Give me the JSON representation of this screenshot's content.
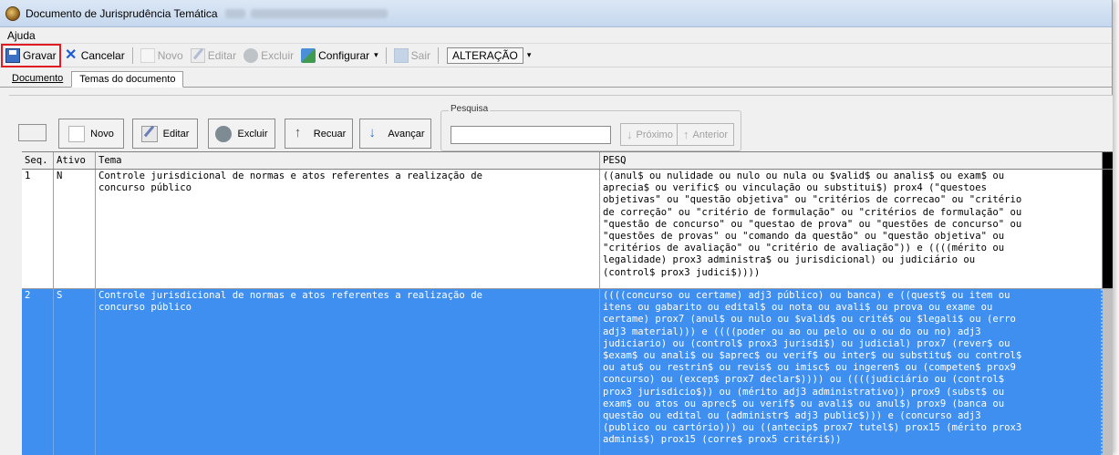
{
  "window": {
    "title": "Documento de Jurisprudência Temática"
  },
  "menu": [
    "Ajuda"
  ],
  "toolbar": {
    "save_label": "Gravar",
    "cancel_label": "Cancelar",
    "new_label": "Novo",
    "edit_label": "Editar",
    "delete_label": "Excluir",
    "config_label": "Configurar",
    "config_caret": "▾",
    "exit_label": "Sair",
    "mode_label": "ALTERAÇÃO",
    "mode_caret": "▾"
  },
  "tabs": [
    {
      "label": "Documento",
      "active": false
    },
    {
      "label": "Temas do documento",
      "active": true
    }
  ],
  "nav": {
    "new_label": "Novo",
    "edit_label": "Editar",
    "delete_label": "Excluir",
    "back_label": "Recuar",
    "forward_label": "Avançar",
    "search_legend": "Pesquisa",
    "search_value": "",
    "next_label": "Próximo",
    "prev_label": "Anterior"
  },
  "grid": {
    "columns": [
      "Seq.",
      "Ativo",
      "Tema",
      "PESQ"
    ],
    "rows": [
      {
        "seq": "1",
        "ativo": "N",
        "tema": "Controle jurisdicional de normas e atos referentes a realização de\nconcurso público",
        "pesq": "((anul$ ou nulidade ou nulo ou nula ou $valid$ ou analis$ ou exam$ ou\naprecia$ ou verific$ ou vinculação ou substitui$) prox4 (\"questoes\nobjetivas\" ou \"questão objetiva\" ou \"critérios de correcao\" ou \"critério\nde correção\" ou \"critério de formulação\" ou \"critérios de formulação\" ou\n\"questão de concurso\" ou \"questao de prova\" ou \"questões de concurso\" ou\n\"questões de provas\" ou \"comando da questão\" ou \"questão objetiva\" ou\n\"critérios de avaliação\" ou \"critério de avaliação\")) e ((((mérito ou\nlegalidade) prox3 administra$ ou jurisdicional) ou judiciário ou\n(control$ prox3 judici$))))",
        "selected": false
      },
      {
        "seq": "2",
        "ativo": "S",
        "tema": "Controle jurisdicional de normas e atos referentes a realização de\nconcurso público",
        "pesq": "((((concurso ou certame) adj3 público) ou banca) e ((quest$ ou item ou\nitens ou gabarito ou edital$ ou nota ou avali$ ou prova ou exame ou\ncertame) prox7 (anul$ ou nulo ou $valid$ ou crité$ ou $legali$ ou (erro\nadj3 material))) e ((((poder ou ao ou pelo ou o ou do ou no) adj3\njudiciario) ou (control$ prox3 jurisdi$) ou judicial) prox7 (rever$ ou\n$exam$ ou anali$ ou $aprec$ ou verif$ ou inter$ ou substitu$ ou control$\nou atu$ ou restrin$ ou revis$ ou imisc$ ou ingeren$ ou (competen$ prox9\nconcurso) ou (excep$ prox7 declar$)))) ou ((((judiciário ou (control$\nprox3 jurisdicio$)) ou (mérito adj3 administrativo)) prox9 (subst$ ou\nexam$ ou atos ou aprec$ ou verif$ ou avali$ ou anul$) prox9 (banca ou\nquestão ou edital ou (administr$ adj3 public$))) e (concurso adj3\n(publico ou cartório))) ou ((antecip$ prox7 tutel$) prox15 (mérito prox3\nadminis$) prox15 (corre$ prox5 critéri$))",
        "selected": true
      }
    ]
  },
  "colors": {
    "selection": "#3e8ff0",
    "highlight_border": "#e11b22"
  }
}
